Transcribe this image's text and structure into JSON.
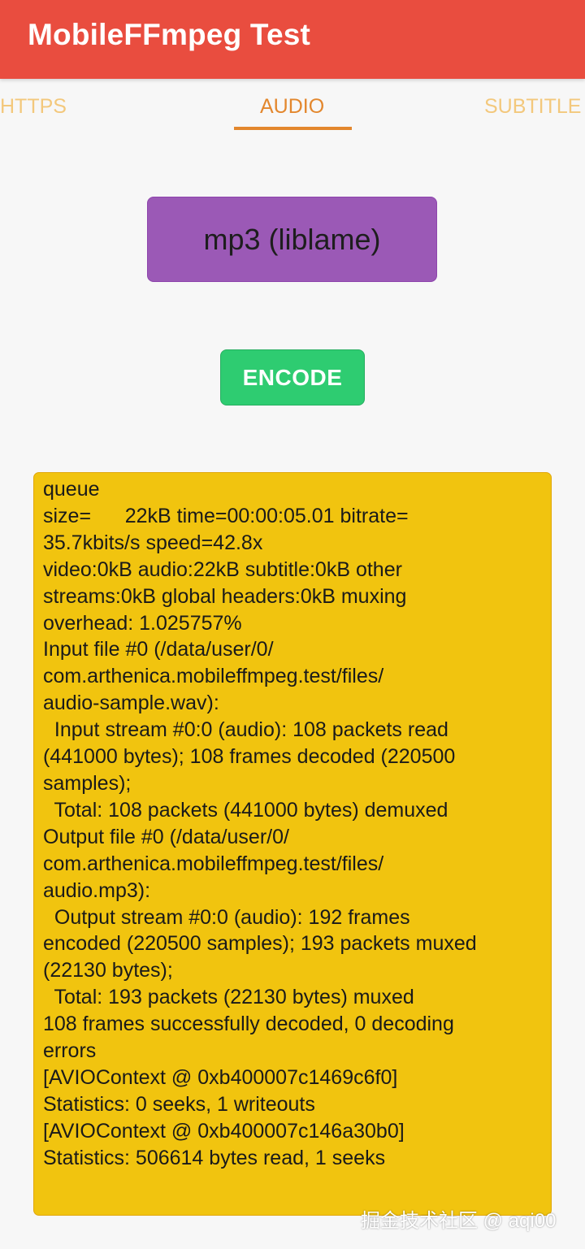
{
  "app_bar": {
    "title": "MobileFFmpeg Test"
  },
  "tabs": [
    {
      "label": "HTTPS",
      "active": false
    },
    {
      "label": "AUDIO",
      "active": true
    },
    {
      "label": "SUBTITLE",
      "active": false
    }
  ],
  "codec_selector": {
    "selected": "mp3 (liblame)"
  },
  "encode_button": {
    "label": "ENCODE"
  },
  "log_output": {
    "text": "queue\nsize=      22kB time=00:00:05.01 bitrate=\n35.7kbits/s speed=42.8x\nvideo:0kB audio:22kB subtitle:0kB other\nstreams:0kB global headers:0kB muxing\noverhead: 1.025757%\nInput file #0 (/data/user/0/\ncom.arthenica.mobileffmpeg.test/files/\naudio-sample.wav):\n  Input stream #0:0 (audio): 108 packets read\n(441000 bytes); 108 frames decoded (220500\nsamples);\n  Total: 108 packets (441000 bytes) demuxed\nOutput file #0 (/data/user/0/\ncom.arthenica.mobileffmpeg.test/files/\naudio.mp3):\n  Output stream #0:0 (audio): 192 frames\nencoded (220500 samples); 193 packets muxed\n(22130 bytes);\n  Total: 193 packets (22130 bytes) muxed\n108 frames successfully decoded, 0 decoding\nerrors\n[AVIOContext @ 0xb400007c1469c6f0]\nStatistics: 0 seeks, 1 writeouts\n[AVIOContext @ 0xb400007c146a30b0]\nStatistics: 506614 bytes read, 1 seeks"
  },
  "watermark": "掘金技术社区 @ aqi00",
  "colors": {
    "app_bar": "#e94d3f",
    "tab_active": "#e3872d",
    "tab_inactive": "#f3c87c",
    "codec_button": "#9b59b6",
    "encode_button": "#2ecc71",
    "log_background": "#f1c40f"
  }
}
